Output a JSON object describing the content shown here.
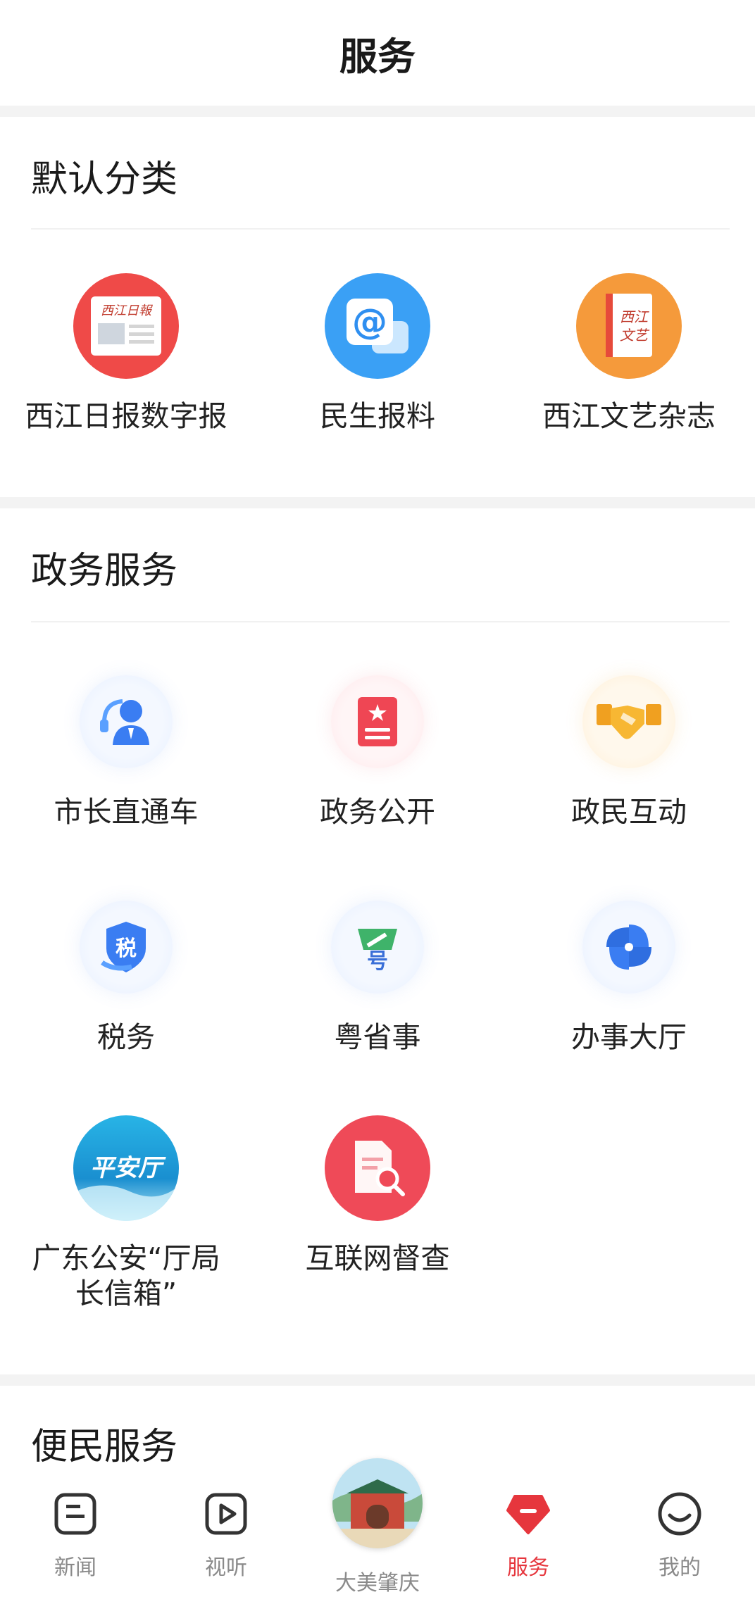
{
  "header": {
    "title": "服务"
  },
  "sections": [
    {
      "title": "默认分类",
      "items": [
        {
          "label": "西江日报数字报",
          "icon": "newspaper-icon",
          "logo_text": "西江日報"
        },
        {
          "label": "民生报料",
          "icon": "at-mail-icon"
        },
        {
          "label": "西江文艺杂志",
          "icon": "book-icon",
          "logo_text": "西江文艺"
        }
      ]
    },
    {
      "title": "政务服务",
      "items": [
        {
          "label": "市长直通车",
          "icon": "customer-service-icon"
        },
        {
          "label": "政务公开",
          "icon": "document-star-icon"
        },
        {
          "label": "政民互动",
          "icon": "handshake-icon"
        },
        {
          "label": "税务",
          "icon": "tax-shield-icon"
        },
        {
          "label": "粤省事",
          "icon": "yue-app-icon"
        },
        {
          "label": "办事大厅",
          "icon": "pinwheel-icon"
        },
        {
          "label": "广东公安“厅局\n长信箱”",
          "icon": "pingan-hall-icon",
          "logo_text": "平安厅"
        },
        {
          "label": "互联网督查",
          "icon": "document-search-icon"
        }
      ]
    },
    {
      "title": "便民服务",
      "items": []
    }
  ],
  "tabbar": [
    {
      "label": "新闻",
      "icon": "news-icon",
      "active": false
    },
    {
      "label": "视听",
      "icon": "play-icon",
      "active": false
    },
    {
      "label": "大美肇庆",
      "icon": "city-gate-icon",
      "active": false
    },
    {
      "label": "服务",
      "icon": "service-icon",
      "active": true
    },
    {
      "label": "我的",
      "icon": "smile-icon",
      "active": false
    }
  ],
  "colors": {
    "accent": "#e6363d",
    "inactive": "#8a8a8a"
  }
}
